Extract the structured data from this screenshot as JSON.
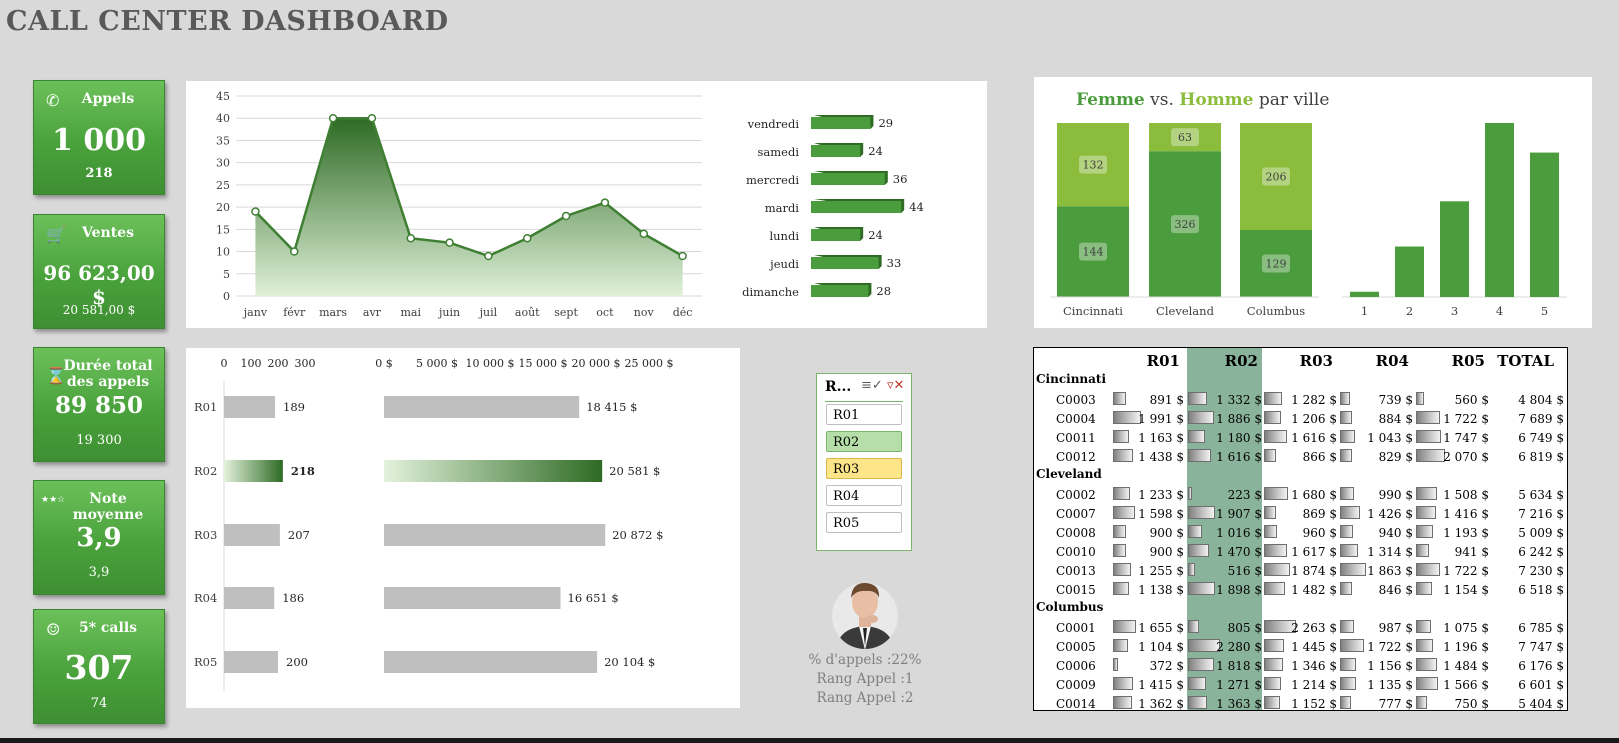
{
  "header": {
    "title": "CALL CENTER DASHBOARD"
  },
  "kpis": [
    {
      "label": "Appels",
      "icon": "phone-icon",
      "value": "1 000",
      "sub": "218"
    },
    {
      "label": "Ventes",
      "icon": "cart-icon",
      "value": "96 623,00 $",
      "sub": "20 581,00 $"
    },
    {
      "label": "Durée total des appels",
      "icon": "hourglass-icon",
      "value": "89 850",
      "sub": "19 300"
    },
    {
      "label": "Note moyenne",
      "icon": "stars-icon",
      "value": "3,9",
      "sub": "3,9"
    },
    {
      "label": "5* calls",
      "icon": "smiley-icon",
      "value": "307",
      "sub": "74"
    }
  ],
  "chart_data": [
    {
      "type": "area",
      "categories": [
        "janv",
        "févr",
        "mars",
        "avr",
        "mai",
        "juin",
        "juil",
        "août",
        "sept",
        "oct",
        "nov",
        "déc"
      ],
      "values": [
        19,
        10,
        40,
        40,
        13,
        12,
        9,
        13,
        18,
        21,
        14,
        9
      ],
      "ylim": [
        0,
        45
      ],
      "yticks": [
        0,
        5,
        10,
        15,
        20,
        25,
        30,
        35,
        40,
        45
      ],
      "grid": true
    },
    {
      "type": "bar",
      "orientation": "horizontal",
      "categories": [
        "vendredi",
        "samedi",
        "mercredi",
        "mardi",
        "lundi",
        "jeudi",
        "dimanche"
      ],
      "values": [
        29,
        24,
        36,
        44,
        24,
        33,
        28
      ],
      "color": "#4a9c3c"
    },
    {
      "type": "bar",
      "stacked": true,
      "title_parts": [
        "Femme",
        " vs. ",
        "Homme",
        " par ville"
      ],
      "categories": [
        "Cincinnati",
        "Cleveland",
        "Columbus"
      ],
      "series": [
        {
          "name": "Homme",
          "values": [
            144,
            326,
            129
          ],
          "color": "#4a9c3c"
        },
        {
          "name": "Femme",
          "values": [
            132,
            63,
            206
          ],
          "color": "#8cbc3c"
        }
      ]
    },
    {
      "type": "bar",
      "categories": [
        "1",
        "2",
        "3",
        "4",
        "5"
      ],
      "values": [
        1,
        16,
        31,
        65,
        65
      ],
      "estimated_heights": [
        3,
        29,
        55,
        100,
        83
      ],
      "color": "#4a9c3c"
    },
    {
      "type": "bar",
      "orientation": "horizontal",
      "categories": [
        "R01",
        "R02",
        "R03",
        "R04",
        "R05"
      ],
      "values": [
        189,
        218,
        207,
        186,
        200
      ],
      "xticks": [
        "0",
        "100",
        "200",
        "300"
      ],
      "xlim": [
        0,
        300
      ],
      "highlight": "R02"
    },
    {
      "type": "bar",
      "orientation": "horizontal",
      "categories": [
        "R01",
        "R02",
        "R03",
        "R04",
        "R05"
      ],
      "values": [
        18415,
        20581,
        20872,
        16651,
        20104
      ],
      "labels": [
        "18 415 $",
        "20 581 $",
        "20 872 $",
        "16 651 $",
        "20 104 $"
      ],
      "xticks": [
        "0 $",
        "5 000 $",
        "10 000 $",
        "15 000 $",
        "20 000 $",
        "25 000 $"
      ],
      "xlim": [
        0,
        25000
      ],
      "highlight": "R02"
    }
  ],
  "slicer": {
    "title": "R...",
    "items": [
      "R01",
      "R02",
      "R03",
      "R04",
      "R05"
    ],
    "selected": "R02",
    "hover": "R03"
  },
  "agent": {
    "pct_line": "% d'appels :22%",
    "rank1": "Rang Appel :1",
    "rank2": "Rang Appel :2"
  },
  "table": {
    "headers": [
      "R01",
      "R02",
      "R03",
      "R04",
      "R05",
      "TOTAL"
    ],
    "groups": [
      {
        "city": "Cincinnati",
        "rows": [
          {
            "code": "C0003",
            "vals": [
              "891 $",
              "1 332 $",
              "1 282 $",
              "739 $",
              "560 $",
              "4 804 $"
            ]
          },
          {
            "code": "C0004",
            "vals": [
              "1 991 $",
              "1 886 $",
              "1 206 $",
              "884 $",
              "1 722 $",
              "7 689 $"
            ]
          },
          {
            "code": "C0011",
            "vals": [
              "1 163 $",
              "1 180 $",
              "1 616 $",
              "1 043 $",
              "1 747 $",
              "6 749 $"
            ]
          },
          {
            "code": "C0012",
            "vals": [
              "1 438 $",
              "1 616 $",
              "866 $",
              "829 $",
              "2 070 $",
              "6 819 $"
            ]
          }
        ]
      },
      {
        "city": "Cleveland",
        "rows": [
          {
            "code": "C0002",
            "vals": [
              "1 233 $",
              "223 $",
              "1 680 $",
              "990 $",
              "1 508 $",
              "5 634 $"
            ]
          },
          {
            "code": "C0007",
            "vals": [
              "1 598 $",
              "1 907 $",
              "869 $",
              "1 426 $",
              "1 416 $",
              "7 216 $"
            ]
          },
          {
            "code": "C0008",
            "vals": [
              "900 $",
              "1 016 $",
              "960 $",
              "940 $",
              "1 193 $",
              "5 009 $"
            ]
          },
          {
            "code": "C0010",
            "vals": [
              "900 $",
              "1 470 $",
              "1 617 $",
              "1 314 $",
              "941 $",
              "6 242 $"
            ]
          },
          {
            "code": "C0013",
            "vals": [
              "1 255 $",
              "516 $",
              "1 874 $",
              "1 863 $",
              "1 722 $",
              "7 230 $"
            ]
          },
          {
            "code": "C0015",
            "vals": [
              "1 138 $",
              "1 898 $",
              "1 482 $",
              "846 $",
              "1 154 $",
              "6 518 $"
            ]
          }
        ]
      },
      {
        "city": "Columbus",
        "rows": [
          {
            "code": "C0001",
            "vals": [
              "1 655 $",
              "805 $",
              "2 263 $",
              "987 $",
              "1 075 $",
              "6 785 $"
            ]
          },
          {
            "code": "C0005",
            "vals": [
              "1 104 $",
              "2 280 $",
              "1 445 $",
              "1 722 $",
              "1 196 $",
              "7 747 $"
            ]
          },
          {
            "code": "C0006",
            "vals": [
              "372 $",
              "1 818 $",
              "1 346 $",
              "1 156 $",
              "1 484 $",
              "6 176 $"
            ]
          },
          {
            "code": "C0009",
            "vals": [
              "1 415 $",
              "1 271 $",
              "1 214 $",
              "1 135 $",
              "1 566 $",
              "6 601 $"
            ]
          },
          {
            "code": "C0014",
            "vals": [
              "1 362 $",
              "1 363 $",
              "1 152 $",
              "777 $",
              "750 $",
              "5 404 $"
            ]
          }
        ]
      }
    ]
  },
  "colors": {
    "accent": "#4a9c3c",
    "dark_green": "#2e6b24",
    "light_green": "#8cbc3c",
    "highlight_col": "#8ab39b",
    "slicer_selected": "#b6dea8",
    "slicer_hover": "#fde58a",
    "gray_bar": "#bfbfbf"
  }
}
